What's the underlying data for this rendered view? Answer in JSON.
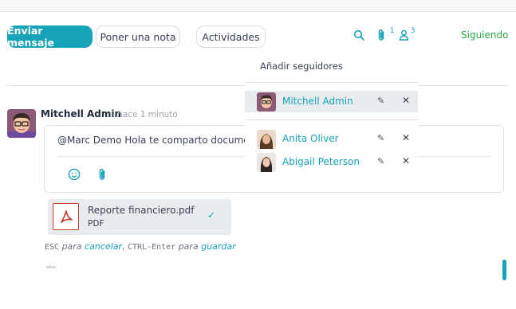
{
  "toolbar": {
    "send_message": "Enviar mensaje",
    "log_note": "Poner una nota",
    "activities": "Actividades",
    "attachments_count": "1",
    "followers_count": "3",
    "following": "Siguiendo"
  },
  "message": {
    "author": "Mitchell Admin",
    "date": "- hace 1 minuto",
    "body": "@Marc Demo Hola te comparto document"
  },
  "attachment": {
    "name": "Reporte financiero.pdf",
    "ext": "PDF"
  },
  "hint": {
    "esc": "ESC",
    "para1": "para",
    "cancel": "cancelar",
    "comma": ",",
    "ctrl_enter": "CTRL-Enter",
    "para2": "para",
    "save": "guardar"
  },
  "footer_tiny": "odoo",
  "followers_dropdown": {
    "header": "Añadir seguidores",
    "followers": [
      {
        "name": "Mitchell Admin"
      },
      {
        "name": "Anita Oliver"
      },
      {
        "name": "Abigail Peterson"
      }
    ]
  },
  "icons": {
    "search": "search-icon",
    "paperclip": "paperclip-icon",
    "user": "user-icon",
    "emoji": "emoji-icon",
    "pdf": "pdf-icon",
    "pencil": "pencil-icon",
    "close": "close-icon",
    "check": "check-icon"
  },
  "colors": {
    "accent": "#17a2b8",
    "following": "#28a745",
    "pdf_red": "#c0392b"
  }
}
